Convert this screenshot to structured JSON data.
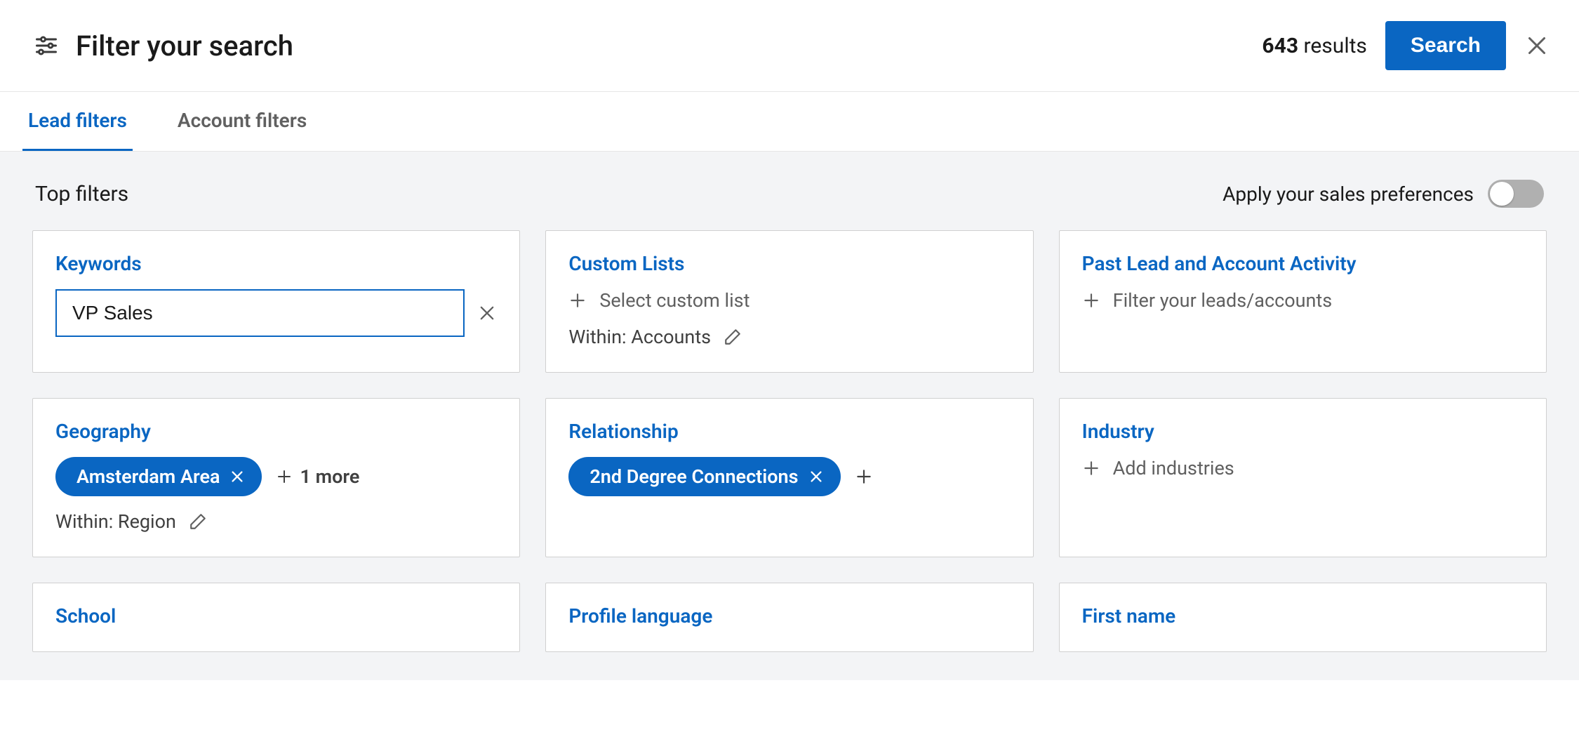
{
  "header": {
    "title": "Filter your search",
    "results_count": "643",
    "results_word": "results",
    "search_label": "Search"
  },
  "tabs": {
    "lead": "Lead filters",
    "account": "Account filters"
  },
  "topfilters": {
    "heading": "Top filters",
    "pref_label": "Apply your sales preferences"
  },
  "cards": {
    "keywords": {
      "title": "Keywords",
      "value": "VP Sales"
    },
    "custom_lists": {
      "title": "Custom Lists",
      "action": "Select custom list",
      "within": "Within: Accounts"
    },
    "past_activity": {
      "title": "Past Lead and Account Activity",
      "action": "Filter your leads/accounts"
    },
    "geography": {
      "title": "Geography",
      "pill": "Amsterdam Area",
      "more": "1 more",
      "within": "Within: Region"
    },
    "relationship": {
      "title": "Relationship",
      "pill": "2nd Degree Connections"
    },
    "industry": {
      "title": "Industry",
      "action": "Add industries"
    },
    "school": {
      "title": "School"
    },
    "profile_language": {
      "title": "Profile language"
    },
    "first_name": {
      "title": "First name"
    }
  }
}
